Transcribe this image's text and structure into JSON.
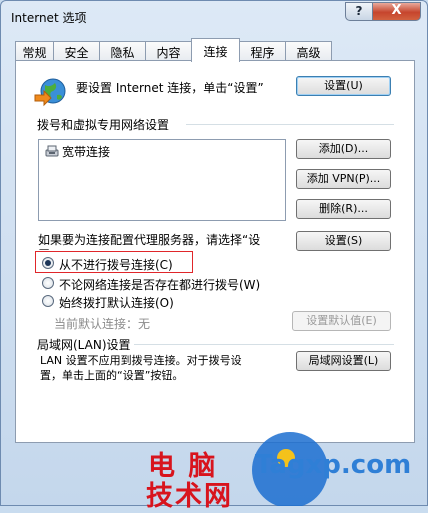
{
  "window": {
    "title": "Internet 选项",
    "help_label": "?",
    "close_label": "X"
  },
  "tabs": [
    "常规",
    "安全",
    "隐私",
    "内容",
    "连接",
    "程序",
    "高级"
  ],
  "active_tab": "连接",
  "setup": {
    "text": "要设置 Internet 连接，单击“设置”",
    "button": "设置(U)"
  },
  "dialup": {
    "header": "拨号和虚拟专用网络设置",
    "items": [
      "宽带连接"
    ],
    "add_button": "添加(D)...",
    "add_vpn_button": "添加 VPN(P)...",
    "delete_button": "删除(R)...",
    "proxy_text": "如果要为连接配置代理服务器，请选择“设置”。",
    "settings_button": "设置(S)",
    "options": [
      "从不进行拨号连接(C)",
      "不论网络连接是否存在都进行拨号(W)",
      "始终拨打默认连接(O)"
    ],
    "selected_option": 0,
    "current_default_label": "当前默认连接：无",
    "set_default_button": "设置默认值(E)"
  },
  "lan": {
    "header": "局域网(LAN)设置",
    "text_line1": "LAN 设置不应用到拨号连接。对于拨号设",
    "text_line2": "置，单击上面的“设置”按钮。",
    "button": "局域网设置(L)"
  },
  "watermark": {
    "cn_line1": "电 脑",
    "cn_line2": "技术网",
    "en": "Tagxp.com"
  },
  "colors": {
    "accent": "#3c7fb1",
    "highlight_box": "#e0262a",
    "watermark_red": "#d8141d",
    "watermark_blue": "#2f7fd6"
  }
}
